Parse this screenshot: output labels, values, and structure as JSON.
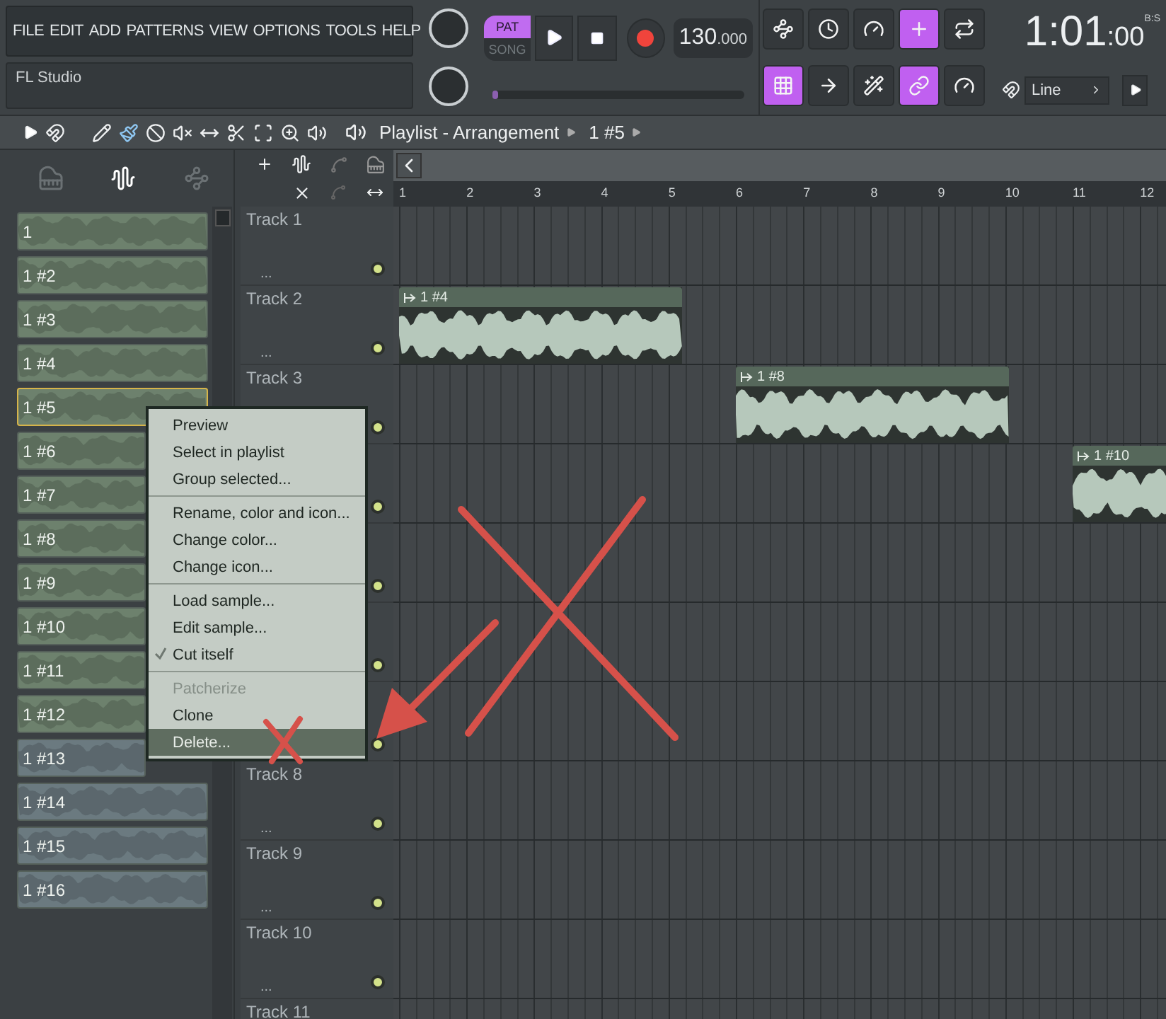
{
  "main_menu": [
    "FILE",
    "EDIT",
    "ADD",
    "PATTERNS",
    "VIEW",
    "OPTIONS",
    "TOOLS",
    "HELP"
  ],
  "hint_bar": {
    "text": "FL Studio"
  },
  "transport": {
    "modes": [
      {
        "label": "PAT",
        "selected": true
      },
      {
        "label": "SONG",
        "selected": false
      }
    ],
    "tempo": "130",
    "tempo_fraction": ".000",
    "record_armed": true,
    "pitch_slider": {
      "level": 0.02
    }
  },
  "tool_buttons": [
    [
      {
        "on": false
      },
      {
        "on": false
      },
      {
        "on": false
      },
      {
        "on": true
      },
      {
        "on": false
      }
    ],
    [
      {
        "on": true
      },
      {
        "on": false
      },
      {
        "on": false
      },
      {
        "on": true
      },
      {
        "on": false
      }
    ]
  ],
  "time": {
    "main": "1:01",
    "sub": ":00",
    "unit": "B:S"
  },
  "snap": {
    "value": "Line"
  },
  "playlist_toolbar": {
    "tools": [
      {
        "on": false
      },
      {
        "on": true
      },
      {
        "on": false
      },
      {
        "on": false
      },
      {
        "on": false
      },
      {
        "on": false
      },
      {
        "on": false
      },
      {
        "on": false
      },
      {
        "on": false
      }
    ],
    "title": "Playlist - Arrangement",
    "pattern": "1 #5"
  },
  "browser": {
    "tabs": [
      {
        "selected": false
      },
      {
        "selected": true
      },
      {
        "selected": false
      }
    ],
    "clips": [
      {
        "label": "1",
        "color": "#6d816d",
        "selected": false
      },
      {
        "label": "1 #2",
        "color": "#6d816d",
        "selected": false
      },
      {
        "label": "1 #3",
        "color": "#6d816d",
        "selected": false
      },
      {
        "label": "1 #4",
        "color": "#6d816d",
        "selected": false
      },
      {
        "label": "1 #5",
        "color": "#6d816d",
        "selected": true
      },
      {
        "label": "1 #6",
        "color": "#6d816d",
        "selected": false
      },
      {
        "label": "1 #7",
        "color": "#6d816d",
        "selected": false
      },
      {
        "label": "1 #8",
        "color": "#6d816d",
        "selected": false
      },
      {
        "label": "1 #9",
        "color": "#6d816d",
        "selected": false
      },
      {
        "label": "1 #10",
        "color": "#6d816d",
        "selected": false
      },
      {
        "label": "1 #11",
        "color": "#6d816d",
        "selected": false
      },
      {
        "label": "1 #12",
        "color": "#6d816d",
        "selected": false
      },
      {
        "label": "1 #13",
        "color": "#6b7a80",
        "selected": false
      },
      {
        "label": "1 #14",
        "color": "#6b7a80",
        "selected": false
      },
      {
        "label": "1 #15",
        "color": "#6b7a80",
        "selected": false
      },
      {
        "label": "1 #16",
        "color": "#6b7a80",
        "selected": false
      }
    ]
  },
  "ruler": [
    "1",
    "2",
    "3",
    "4",
    "5",
    "6",
    "7",
    "8",
    "9",
    "10",
    "11",
    "12"
  ],
  "tracks": [
    {
      "name": "Track 1",
      "more": "...",
      "indicator_on": true
    },
    {
      "name": "Track 2",
      "more": "...",
      "indicator_on": true,
      "clip": {
        "label": "1 #4"
      }
    },
    {
      "name": "Track 3",
      "indicator_on": true,
      "clip": {
        "label": "1 #8"
      }
    },
    {
      "indicator_on": true,
      "clip": {
        "label": "1 #10"
      }
    },
    {
      "indicator_on": true
    },
    {
      "indicator_on": true
    },
    {
      "indicator_on": true
    },
    {
      "name": "Track 8",
      "more": "...",
      "indicator_on": true
    },
    {
      "name": "Track 9",
      "more": "...",
      "indicator_on": true
    },
    {
      "name": "Track 10",
      "more": "...",
      "indicator_on": true
    },
    {
      "name": "Track 11"
    }
  ],
  "context_menu": {
    "groups": [
      [
        {
          "label": "Preview",
          "checked": false,
          "disabled": false,
          "selected": false
        },
        {
          "label": "Select in playlist",
          "checked": false,
          "disabled": false,
          "selected": false
        },
        {
          "label": "Group selected...",
          "checked": false,
          "disabled": false,
          "selected": false
        }
      ],
      [
        {
          "label": "Rename, color and icon...",
          "checked": false,
          "disabled": false,
          "selected": false
        },
        {
          "label": "Change color...",
          "checked": false,
          "disabled": false,
          "selected": false
        },
        {
          "label": "Change icon...",
          "checked": false,
          "disabled": false,
          "selected": false
        }
      ],
      [
        {
          "label": "Load sample...",
          "checked": false,
          "disabled": false,
          "selected": false
        },
        {
          "label": "Edit sample...",
          "checked": false,
          "disabled": false,
          "selected": false
        },
        {
          "label": "Cut itself",
          "checked": true,
          "disabled": false,
          "selected": false
        }
      ],
      [
        {
          "label": "Patcherize",
          "checked": false,
          "disabled": true,
          "selected": false
        },
        {
          "label": "Clone",
          "checked": false,
          "disabled": false,
          "selected": false
        },
        {
          "label": "Delete...",
          "checked": false,
          "disabled": false,
          "selected": true
        }
      ]
    ]
  }
}
